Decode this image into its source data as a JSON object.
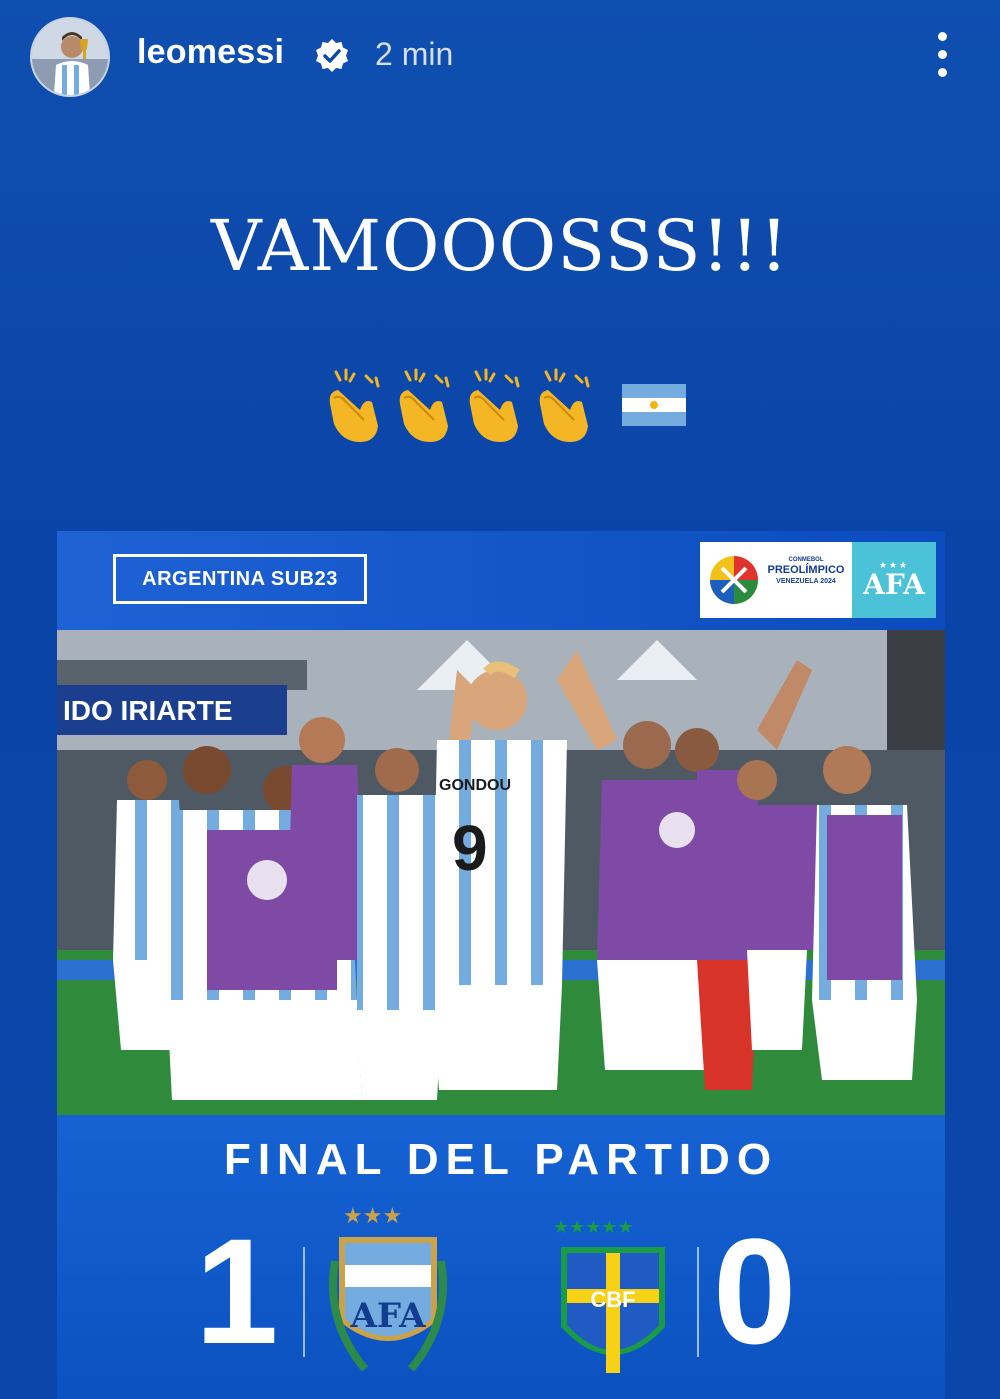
{
  "header": {
    "username": "leomessi",
    "timestamp": "2 min",
    "verified_icon": "verified-badge-icon",
    "more_icon": "more-vertical-icon"
  },
  "story": {
    "caption": "VAMOOOSSS!!!",
    "emojis": [
      "clapping-hands",
      "clapping-hands",
      "clapping-hands",
      "clapping-hands",
      "argentina-flag"
    ]
  },
  "post": {
    "team_tag": "ARGENTINA SUB23",
    "sponsor": {
      "org": "CONMEBOL",
      "event": "PREOLÍMPICO",
      "place": "VENEZUELA 2024",
      "federation": "AFA"
    },
    "stadium_banner": "IDO IRIARTE",
    "player_name": "GONDOU",
    "player_number": "9",
    "result_title": "FINAL DEL PARTIDO",
    "home": {
      "crest_text": "AFA",
      "score": "1"
    },
    "away": {
      "crest_text": "CBF",
      "score": "0"
    }
  },
  "colors": {
    "background": "#0b47ab",
    "post_blue": "#0d55c4",
    "afa_cyan": "#4cc2d8",
    "argentina_sky": "#74acdf",
    "brazil_green": "#1a9b47",
    "brazil_yellow": "#f7d116"
  }
}
